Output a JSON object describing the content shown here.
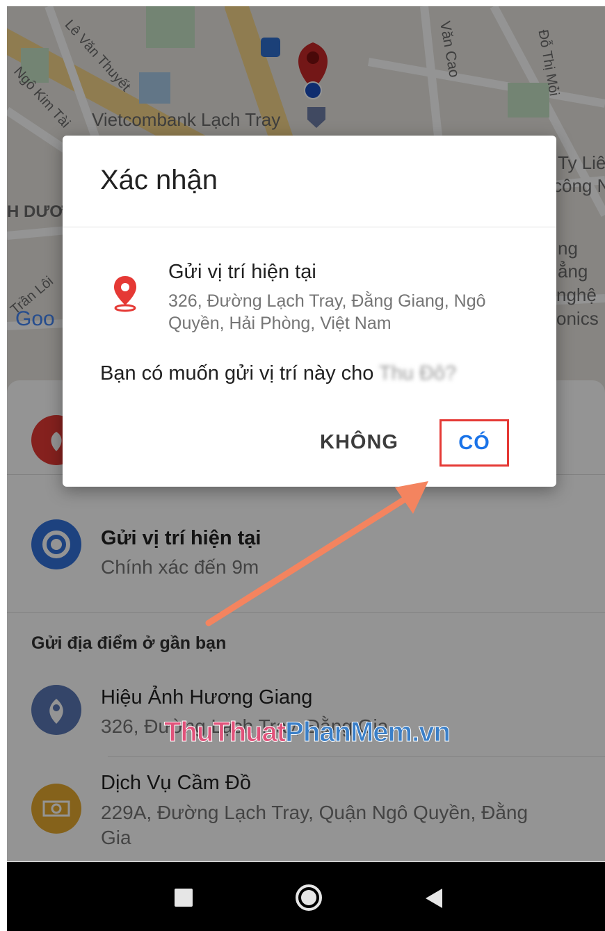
{
  "map": {
    "labels": [
      "Lê Văn Thuyết",
      "Ngô Kim Tài",
      "Vietcombank Lạch Tray",
      "Văn Cao",
      "Đỗ Thị Mỏi",
      "Ty Liê",
      "công N",
      "H DƯƠ",
      "ng",
      "ẳng",
      "nghệ",
      "onics",
      "Trần Lôi",
      "Goo"
    ]
  },
  "dialog": {
    "title": "Xác nhận",
    "location_title": "Gửi vị trí hiện tại",
    "location_address": "326, Đường Lạch Tray, Đằng Giang, Ngô Quyền, Hải Phòng, Việt Nam",
    "question_prefix": "Bạn có muốn gửi vị trí này cho",
    "question_recipient": " Thu Đô?",
    "no_label": "KHÔNG",
    "yes_label": "CÓ"
  },
  "sheet": {
    "current_title": "Gửi vị trí hiện tại",
    "current_sub": "Chính xác đến 9m",
    "nearby_header": "Gửi địa điểm ở gần bạn",
    "places": [
      {
        "name": "Hiệu Ảnh Hương Giang",
        "address": "326, Đường Lạch Tray, Đằng Gia"
      },
      {
        "name": "Dịch Vụ Cầm Đồ",
        "address_line1": "229A, Đường Lạch Tray, Quận Ngô Quyền, Đằng",
        "address_line2": "Gia"
      }
    ]
  },
  "watermark": {
    "part1": "ThuThuat",
    "part2": "PhanMem.vn"
  },
  "colors": {
    "accent": "#1a73e8",
    "highlight": "#e53935",
    "arrow": "#f4845f",
    "pin": "#e53935"
  },
  "icons": [
    "stop-icon",
    "home-icon",
    "back-icon",
    "location-pin-icon",
    "target-icon",
    "money-icon"
  ]
}
